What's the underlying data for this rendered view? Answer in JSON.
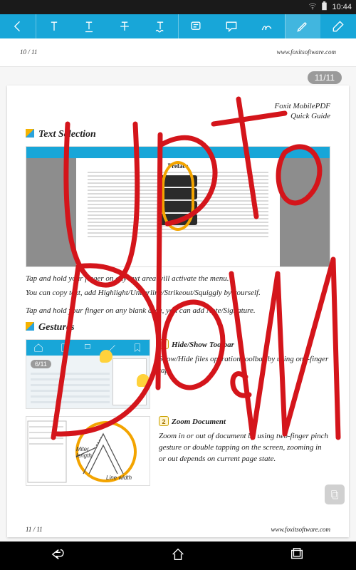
{
  "status": {
    "time": "10:44"
  },
  "toolbar": {
    "items": [
      {
        "name": "back-icon"
      },
      {
        "name": "text-highlight-icon"
      },
      {
        "name": "text-underline-icon"
      },
      {
        "name": "text-strikeout-icon"
      },
      {
        "name": "text-squiggle-icon"
      },
      {
        "name": "note-icon"
      },
      {
        "name": "comment-icon"
      },
      {
        "name": "signature-icon"
      },
      {
        "name": "pencil-icon"
      },
      {
        "name": "eraser-icon"
      }
    ]
  },
  "prevPage": {
    "indicator": "10 / 11",
    "url": "www.foxitsoftware.com"
  },
  "pageBadge": "11/11",
  "doc": {
    "headerLine1": "Foxit MobilePDF",
    "headerLine2": "Quick Guide",
    "section1": "Text Selection",
    "thumb1Title": "Preface",
    "para1": "Tap and hold your finger on any text area will activate the menu.",
    "para2": "You can copy text, add Highlight/Underline/Strikeout/Squiggly by yourself.",
    "para3": "Tap and hold your finger on any blank area, you can add Note/Signature.",
    "section2": "Gestures",
    "thumb2Badge": "6/11",
    "step1": {
      "num": "1",
      "title": "Hide/Show Toolbar",
      "body": "Show/Hide files operation toolbar by using one-finger tap."
    },
    "step2": {
      "num": "2",
      "title": "Zoom Document",
      "body": "Zoom in or out of document by using two-finger pinch gesture or double tapping on the screen, zooming in or out depends on current page state."
    },
    "miterLabel1": "Miter",
    "miterLabel2": "length",
    "lineWidthLabel": "Line width",
    "footerLeft": "11 / 11",
    "footerRight": "www.foxitsoftware.com"
  },
  "ink": {
    "color": "#d4151b"
  }
}
